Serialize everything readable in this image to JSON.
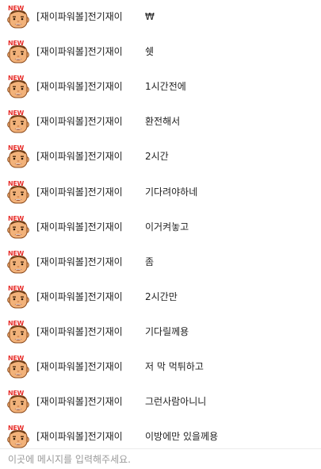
{
  "chat": {
    "badge_text": "NEW",
    "messages": [
      {
        "nickname": "[재이파워볼]전기재이",
        "text": "₩"
      },
      {
        "nickname": "[재이파워볼]전기재이",
        "text": "쉣"
      },
      {
        "nickname": "[재이파워볼]전기재이",
        "text": "1시간전에"
      },
      {
        "nickname": "[재이파워볼]전기재이",
        "text": "환전해서"
      },
      {
        "nickname": "[재이파워볼]전기재이",
        "text": "2시간"
      },
      {
        "nickname": "[재이파워볼]전기재이",
        "text": "기다려야하네"
      },
      {
        "nickname": "[재이파워볼]전기재이",
        "text": "이거켜놓고"
      },
      {
        "nickname": "[재이파워볼]전기재이",
        "text": "좀"
      },
      {
        "nickname": "[재이파워볼]전기재이",
        "text": "2시간만"
      },
      {
        "nickname": "[재이파워볼]전기재이",
        "text": "기다릴께용"
      },
      {
        "nickname": "[재이파워볼]전기재이",
        "text": "저 막 먹튀하고"
      },
      {
        "nickname": "[재이파워볼]전기재이",
        "text": "그런사람아니니"
      },
      {
        "nickname": "[재이파워볼]전기재이",
        "text": "이방에만 있을께용"
      }
    ]
  },
  "composer": {
    "placeholder": "이곳에 메시지를 입력해주세요.",
    "value": ""
  },
  "colors": {
    "badge": "#e8312d",
    "face_skin": "#f2b27a",
    "text": "#222222",
    "placeholder": "#9a9a9a"
  },
  "icons": {
    "avatar": "new-member-face-icon"
  }
}
